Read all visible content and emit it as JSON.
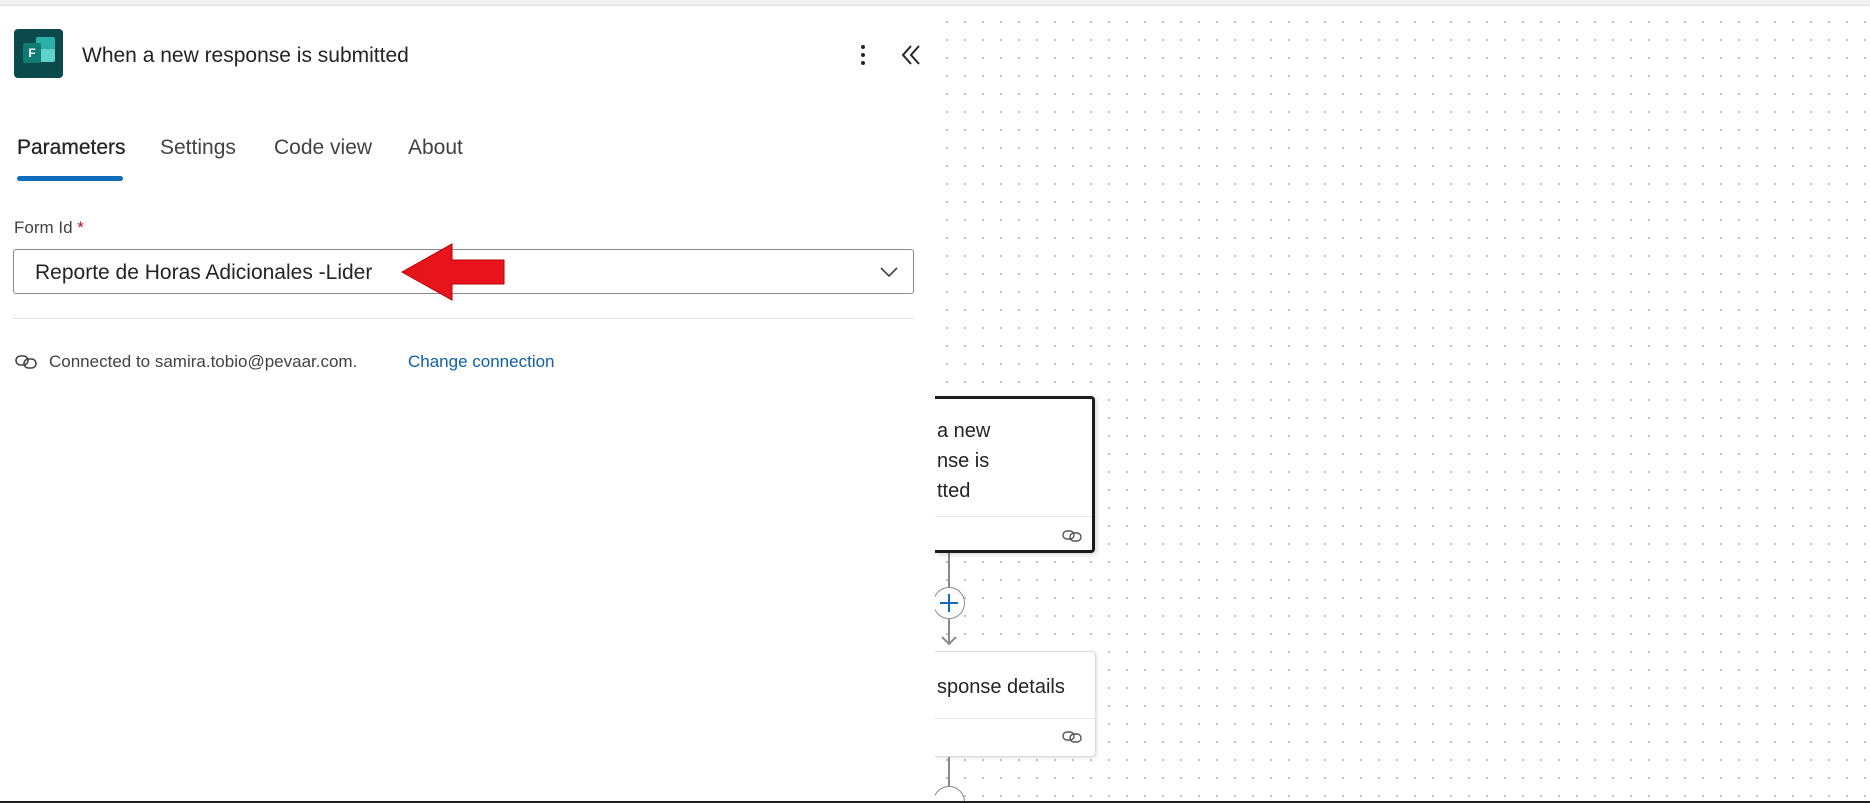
{
  "panel": {
    "title": "When a new response is submitted",
    "app_icon": "microsoft-forms-icon",
    "more_icon": "more-vertical-icon",
    "collapse_icon": "double-chevron-left-icon"
  },
  "tabs": [
    {
      "label": "Parameters",
      "active": true
    },
    {
      "label": "Settings",
      "active": false
    },
    {
      "label": "Code view",
      "active": false
    },
    {
      "label": "About",
      "active": false
    }
  ],
  "form_id": {
    "label": "Form Id",
    "required_marker": "*",
    "value": "Reporte de Horas Adicionales -Lider"
  },
  "connection": {
    "text": "Connected to samira.tobio@pevaar.com.",
    "link": "Change connection",
    "icon": "link-icon"
  },
  "canvas": {
    "node1_lines": [
      "a new",
      "nse is",
      "tted"
    ],
    "node2_title": "sponse details"
  },
  "colors": {
    "accent": "#0f6cbd",
    "link": "#115ea3",
    "required": "#c50f1f",
    "annotation_arrow": "#e8141c"
  }
}
